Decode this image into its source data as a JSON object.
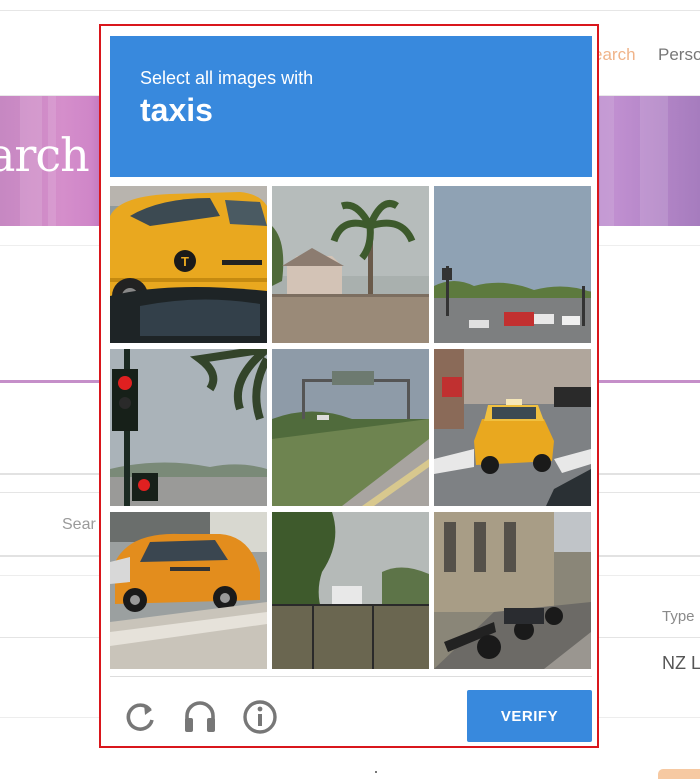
{
  "background": {
    "nav": {
      "search_fragment": "earch",
      "personal_fragment": "Perso"
    },
    "banner": {
      "title_fragment": "arch"
    },
    "search": {
      "placeholder_fragment": "Sear"
    },
    "table": {
      "type_header_fragment": "Type",
      "row_value_fragment": "NZ L"
    }
  },
  "captcha": {
    "prompt": "Select all images with",
    "keyword": "taxis",
    "tiles": [
      {
        "content": "taxi close-up"
      },
      {
        "content": "palm tree and building"
      },
      {
        "content": "road with truck"
      },
      {
        "content": "traffic light and palm"
      },
      {
        "content": "highway sign"
      },
      {
        "content": "taxi at intersection"
      },
      {
        "content": "taxi on curb"
      },
      {
        "content": "trees and fence"
      },
      {
        "content": "motorcycles on street"
      }
    ],
    "controls": {
      "reload_icon": "reload-icon",
      "audio_icon": "headphones-icon",
      "info_icon": "info-icon"
    },
    "verify_label": "VERIFY"
  },
  "colors": {
    "accent": "#3889dd",
    "border": "#d9161c",
    "taxi": "#e9a81f"
  }
}
